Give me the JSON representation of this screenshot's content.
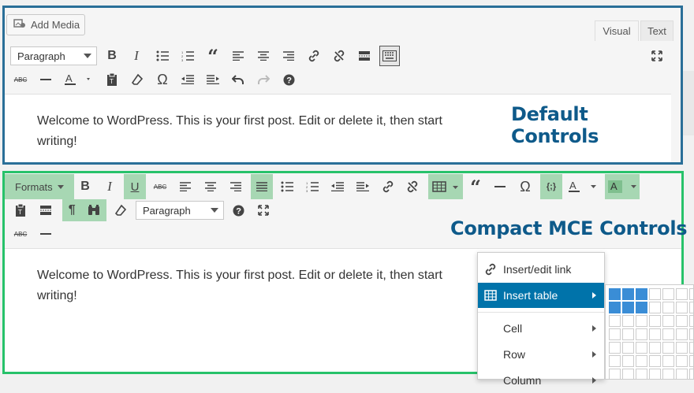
{
  "default_editor": {
    "add_media_label": "Add Media",
    "tabs": {
      "visual": "Visual",
      "text": "Text"
    },
    "format_select": "Paragraph",
    "body_text": "Welcome to WordPress. This is your first post. Edit or delete it, then start writing!",
    "heading": "Default Controls"
  },
  "compact_editor": {
    "formats_label": "Formats",
    "format_select": "Paragraph",
    "body_text": "Welcome to WordPress. This is your first post. Edit or delete it, then start writing!",
    "heading": "Compact MCE Controls"
  },
  "table_menu": {
    "items": [
      "Insert/edit link",
      "Insert table",
      "Cell",
      "Row",
      "Column"
    ]
  },
  "table_grid": {
    "selected_cols": 3,
    "selected_rows": 2
  },
  "colors": {
    "default_border": "#2a6f98",
    "compact_border": "#27c26a",
    "highlight": "#a7d7b3",
    "accent": "#0073aa"
  }
}
